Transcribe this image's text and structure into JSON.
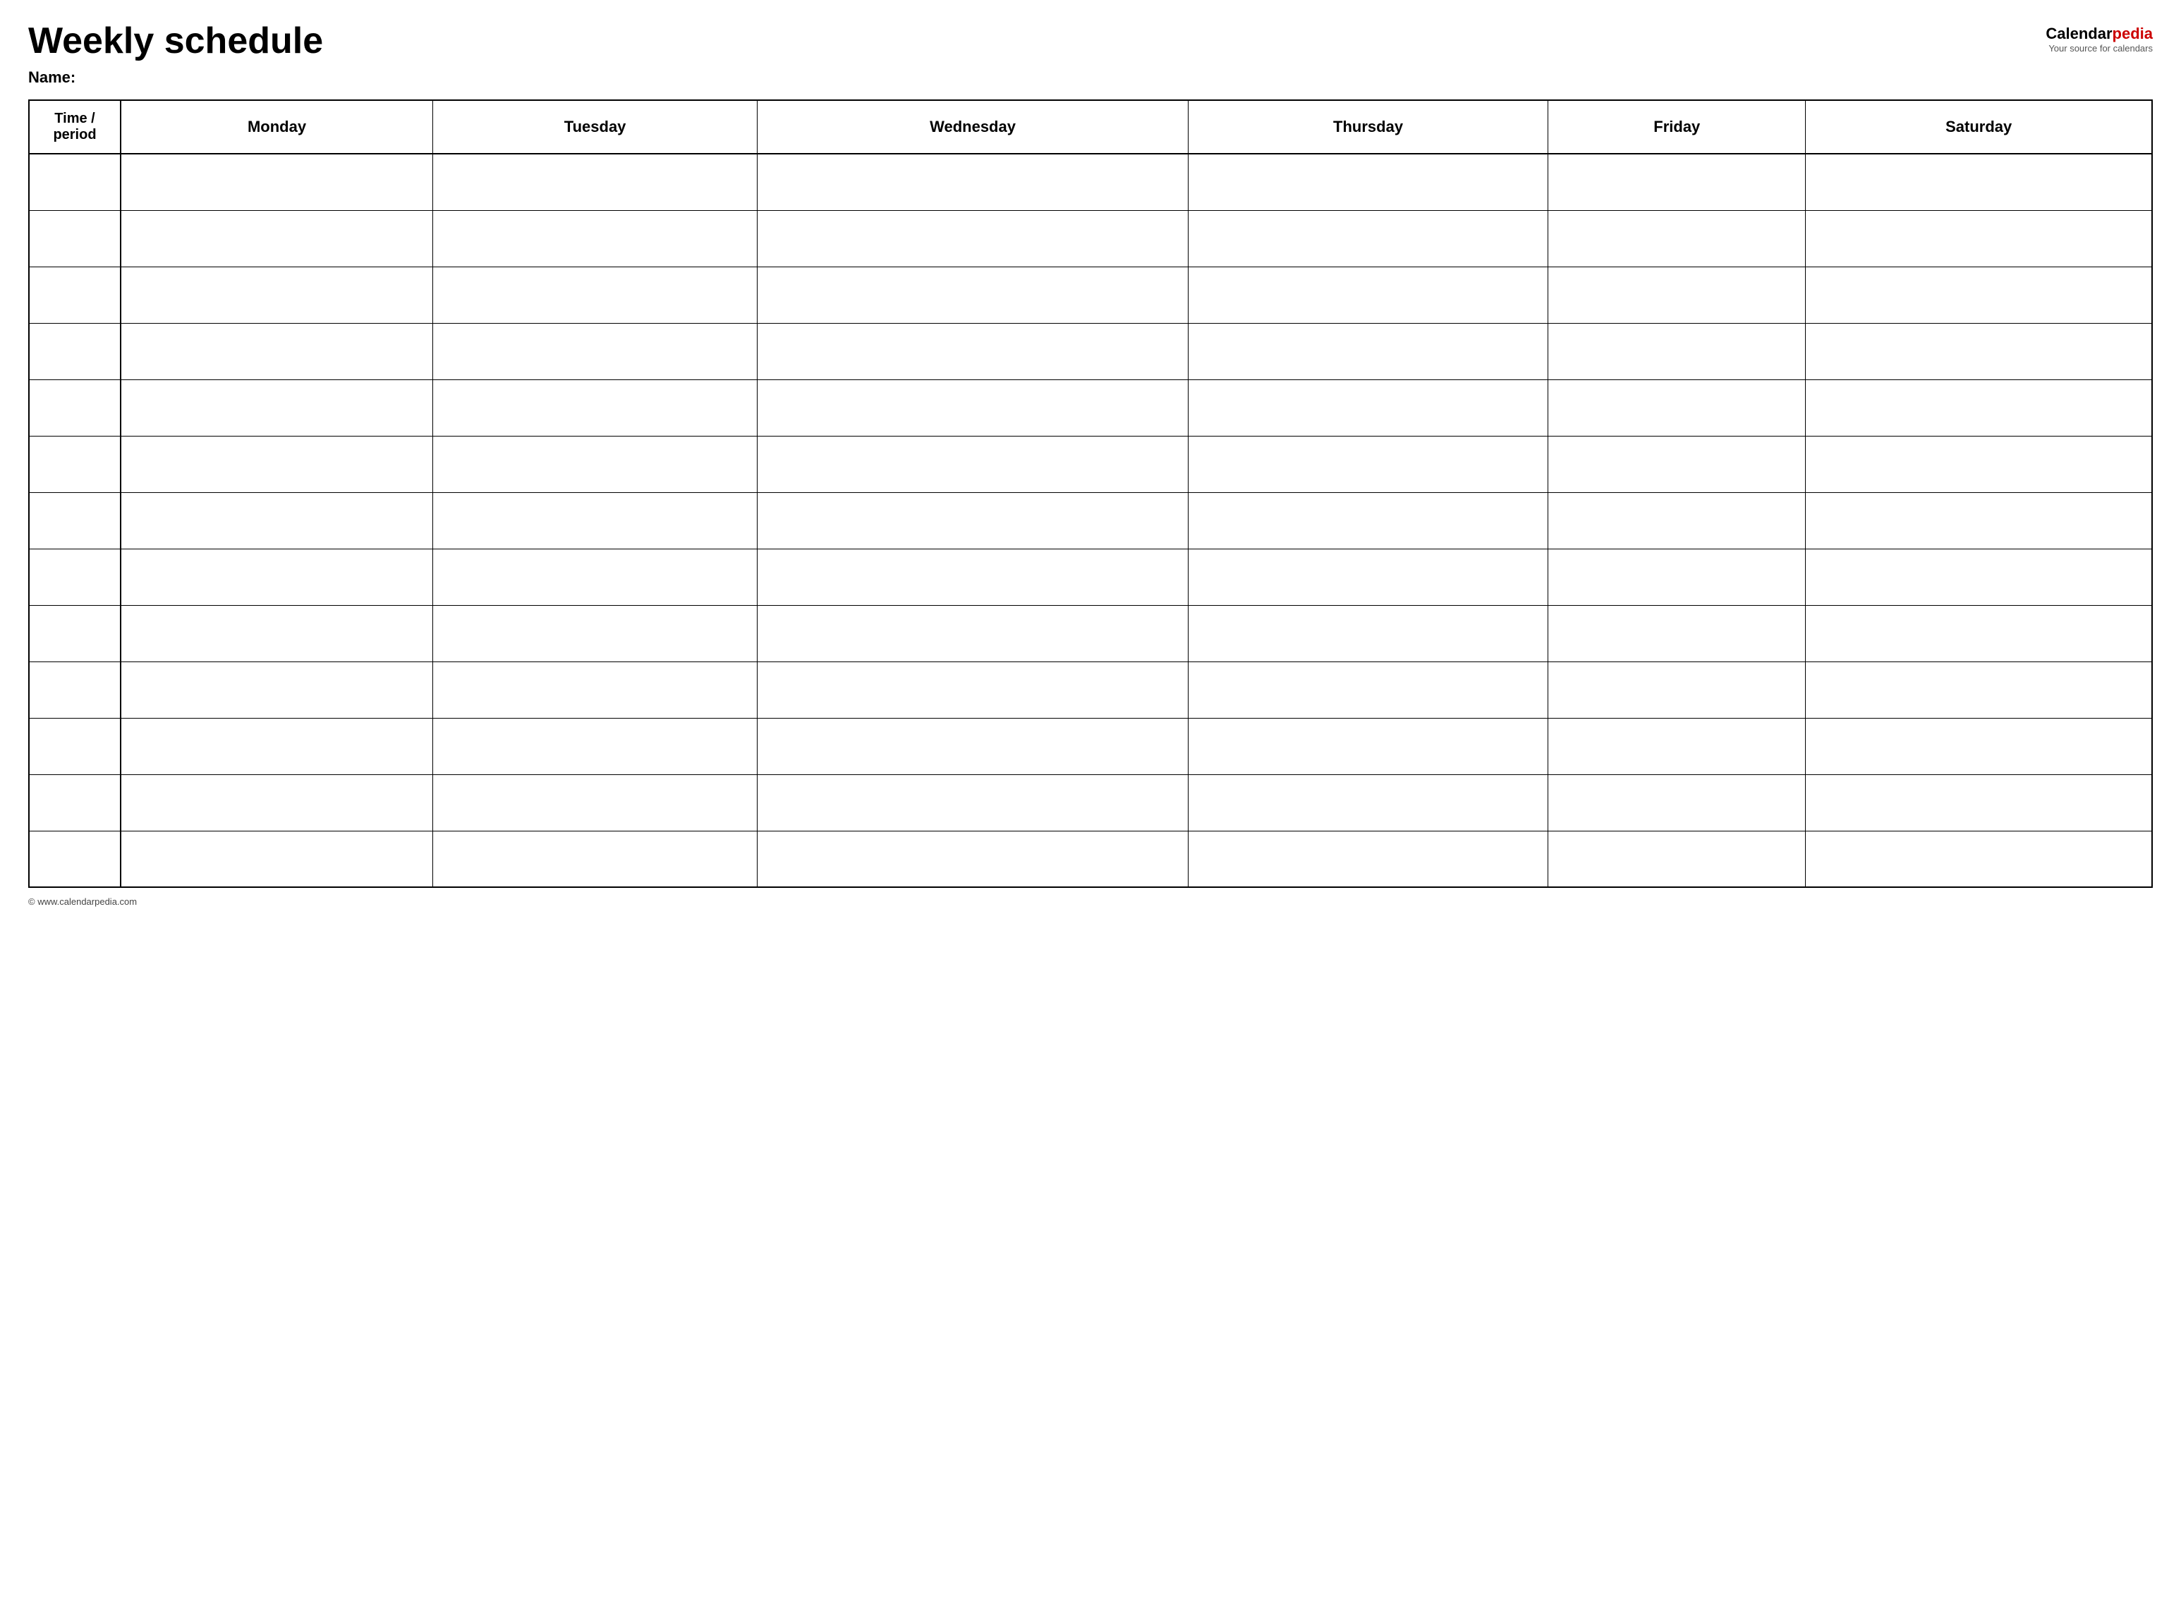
{
  "header": {
    "title": "Weekly schedule",
    "logo": {
      "calendar": "Calendar",
      "pedia": "pedia",
      "subtitle": "Your source for calendars"
    },
    "name_label": "Name:"
  },
  "table": {
    "columns": [
      "Time / period",
      "Monday",
      "Tuesday",
      "Wednesday",
      "Thursday",
      "Friday",
      "Saturday"
    ],
    "row_count": 13
  },
  "footer": {
    "text": "© www.calendarpedia.com"
  }
}
